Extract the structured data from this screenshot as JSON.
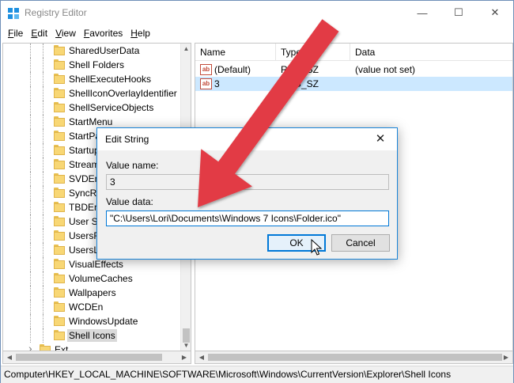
{
  "window": {
    "title": "Registry Editor",
    "controls": {
      "minimize": "—",
      "maximize": "☐",
      "close": "✕"
    }
  },
  "menu": [
    {
      "label": "File",
      "accel": "F",
      "rest": "ile"
    },
    {
      "label": "Edit",
      "accel": "E",
      "rest": "dit"
    },
    {
      "label": "View",
      "accel": "V",
      "rest": "iew"
    },
    {
      "label": "Favorites",
      "accel": "F",
      "rest": "avorites"
    },
    {
      "label": "Help",
      "accel": "H",
      "rest": "elp"
    }
  ],
  "tree": {
    "items": [
      "SharedUserData",
      "Shell Folders",
      "ShellExecuteHooks",
      "ShellIconOverlayIdentifier",
      "ShellServiceObjects",
      "StartMenu",
      "StartPa",
      "Startup",
      "Stream",
      "SVDEn",
      "SyncRo",
      "TBDEn",
      "User Sh",
      "UsersFi",
      "UsersLi",
      "VisualEffects",
      "VolumeCaches",
      "Wallpapers",
      "WCDEn",
      "WindowsUpdate",
      "Shell Icons"
    ],
    "selected": "Shell Icons",
    "last_item": "Ext"
  },
  "list": {
    "columns": {
      "name": "Name",
      "type": "Type",
      "data": "Data"
    },
    "rows": [
      {
        "icon": "ab",
        "name": "(Default)",
        "type": "REG_SZ",
        "data": "(value not set)",
        "selected": false
      },
      {
        "icon": "ab",
        "name": "3",
        "type": "REG_SZ",
        "data": "",
        "selected": true
      }
    ]
  },
  "status": {
    "path": "Computer\\HKEY_LOCAL_MACHINE\\SOFTWARE\\Microsoft\\Windows\\CurrentVersion\\Explorer\\Shell Icons"
  },
  "dialog": {
    "title": "Edit String",
    "close": "✕",
    "value_name_label": "Value name:",
    "value_name_accel": "N",
    "value_name": "3",
    "value_data_label": "Value data:",
    "value_data_accel": "V",
    "value_data": "\"C:\\Users\\Lori\\Documents\\Windows 7 Icons\\Folder.ico\"",
    "ok": "OK",
    "cancel": "Cancel"
  },
  "colors": {
    "accent": "#0078d7",
    "arrow": "#e23b44",
    "selection": "#cce8ff"
  }
}
